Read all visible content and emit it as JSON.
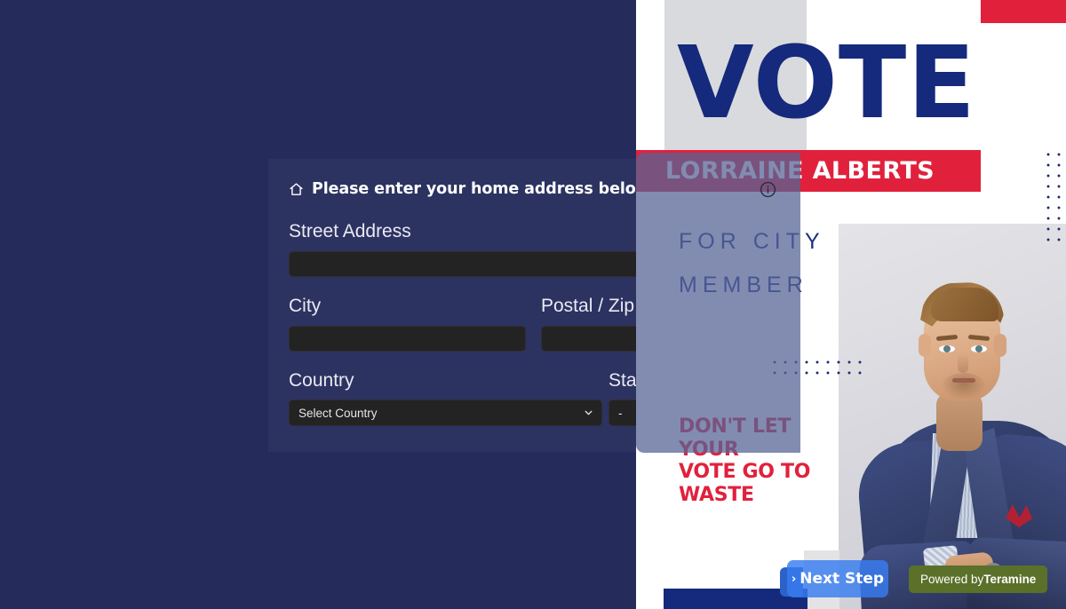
{
  "form": {
    "heading": "Please enter your home address below",
    "heading_icon": "home-icon",
    "fields": {
      "street_label": "Street Address",
      "street_value": "",
      "street_placeholder": "",
      "city_label": "City",
      "city_value": "",
      "city_placeholder": "",
      "zip_label": "Postal / Zip code",
      "zip_value": "",
      "zip_placeholder": "",
      "country_label": "Country",
      "country_value": "Select Country",
      "state_label": "State / Province",
      "state_value": "-"
    }
  },
  "poster": {
    "headline": "VOTE",
    "candidate_name": "LORRAINE ALBERTS",
    "office_line1": "FOR CITY",
    "office_line2": "MEMBER",
    "slogan_line1": "DON'T LET",
    "slogan_line2": "YOUR",
    "slogan_line3": "VOTE GO TO",
    "slogan_line4": "WASTE",
    "info_icon": "info-circle-icon"
  },
  "footer": {
    "next_step_label": "Next Step",
    "next_step_chevron": "›",
    "powered_prefix": "Powered by",
    "powered_brand": "Teramine"
  },
  "colors": {
    "navy_bg": "#252c5c",
    "poster_blue": "#152a7c",
    "poster_red": "#e1213c",
    "field_bg": "#232323",
    "next_step_blue": "#387cf0",
    "powered_green": "#5b7029",
    "overlay": "rgba(86,100,150,0.74)"
  }
}
